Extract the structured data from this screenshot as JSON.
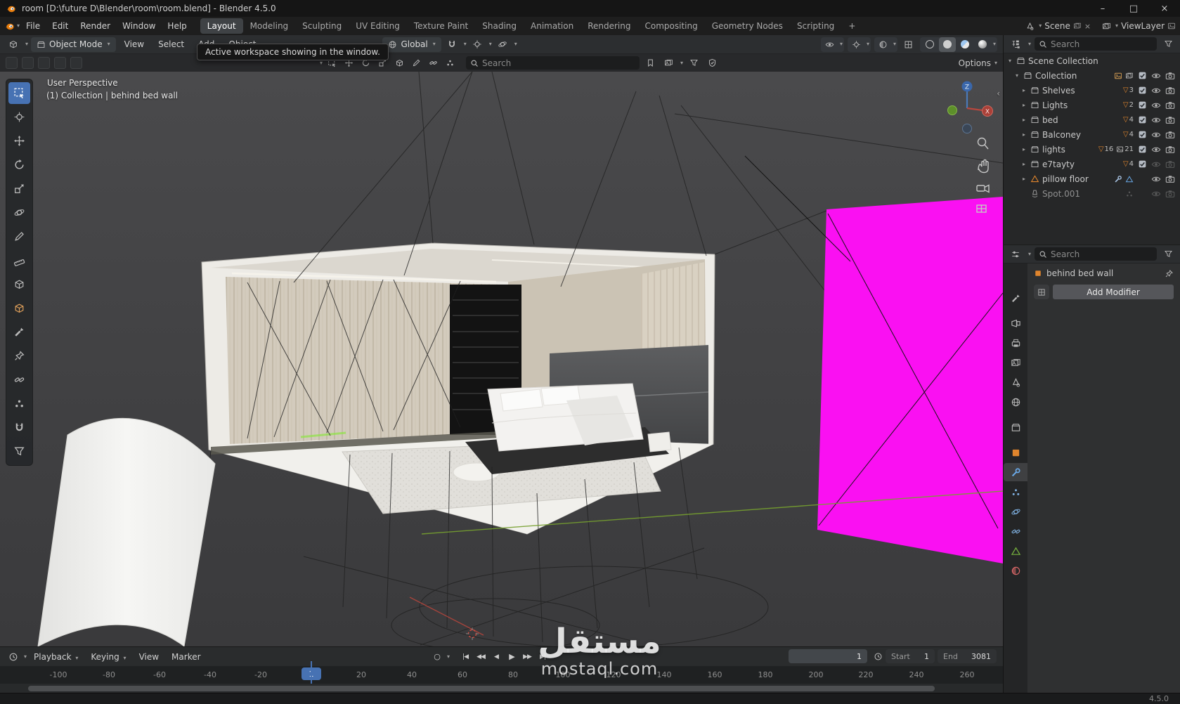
{
  "window": {
    "title": "room [D:\\future D\\Blender\\room\\room.blend] - Blender 4.5.0",
    "version": "4.5.0"
  },
  "glyphs": {
    "chevron": "▾",
    "arrow_right": "▸",
    "arrow_down": "▾",
    "triangle": "▽",
    "minimize": "–",
    "maximize": "□",
    "close": "×",
    "record": "○",
    "jump_start": "|◀",
    "prev_key": "◀◀",
    "play_reverse": "◀",
    "play": "▶",
    "next_key": "▶▶",
    "jump_end": "▶|",
    "collapse_left": "‹"
  },
  "menubar": {
    "menus": [
      "File",
      "Edit",
      "Render",
      "Window",
      "Help"
    ],
    "workspaces": [
      "Layout",
      "Modeling",
      "Sculpting",
      "UV Editing",
      "Texture Paint",
      "Shading",
      "Animation",
      "Rendering",
      "Compositing",
      "Geometry Nodes",
      "Scripting"
    ],
    "add_tab": "+",
    "scene_name": "Scene",
    "view_layer_name": "ViewLayer"
  },
  "tooltip": {
    "text": "Active workspace showing in the window."
  },
  "viewport_header": {
    "mode": "Object Mode",
    "view_menu": "View",
    "select_menu": "Select",
    "add_menu": "Add",
    "object_menu": "Object",
    "orientation": "Global",
    "search_placeholder": "Search",
    "options": "Options"
  },
  "viewport": {
    "perspective": "User Perspective",
    "collection_info": "(1) Collection | behind bed wall",
    "axis_x": "X",
    "axis_z": "Z"
  },
  "outliner": {
    "search_placeholder": "Search",
    "root_label": "Scene Collection",
    "items": [
      {
        "label": "Collection"
      },
      {
        "label": "Shelves",
        "count": "3"
      },
      {
        "label": "Lights",
        "count": "2"
      },
      {
        "label": "bed",
        "count": "4"
      },
      {
        "label": "Balconey",
        "count": "4"
      },
      {
        "label": "lights",
        "count": "16",
        "count2": "21"
      },
      {
        "label": "e7tayty",
        "count": "4"
      },
      {
        "label": "pillow floor"
      },
      {
        "label": "Spot.001"
      }
    ]
  },
  "properties": {
    "search_placeholder": "Search",
    "active_object": "behind bed wall",
    "add_modifier": "Add Modifier"
  },
  "timeline": {
    "playback": "Playback",
    "keying": "Keying",
    "view": "View",
    "marker": "Marker",
    "current_frame": "1",
    "start_label": "Start",
    "start_value": "1",
    "end_label": "End",
    "end_value": "3081",
    "ticks": [
      "-100",
      "-80",
      "-60",
      "-40",
      "-20",
      "20",
      "40",
      "60",
      "80",
      "100",
      "120",
      "140",
      "160",
      "180",
      "200",
      "220",
      "240",
      "260"
    ]
  },
  "watermark": {
    "arabic": "مستقل",
    "domain": "mostaql.com"
  },
  "colors": {
    "accent": "#4772b3",
    "magenta": "#fa10f2",
    "object_orange": "#e0852d",
    "modifier_blue": "#6aa9e8",
    "data_green": "#77b33e",
    "axis_red": "#b2453c",
    "axis_green": "#76a02f",
    "axis_blue": "#3b66a8"
  }
}
